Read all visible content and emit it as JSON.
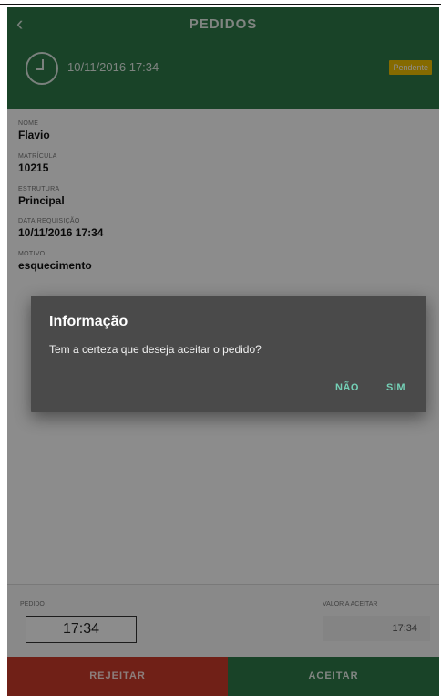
{
  "appbar": {
    "title": "PEDIDOS",
    "back_icon": "chevron-left-icon"
  },
  "header": {
    "datetime": "10/11/2016 17:34",
    "status": "Pendente"
  },
  "details": {
    "fields": [
      {
        "label": "NOME",
        "value": "Flavio"
      },
      {
        "label": "MATRÍCULA",
        "value": "10215"
      },
      {
        "label": "ESTRUTURA",
        "value": "Principal"
      },
      {
        "label": "DATA REQUISIÇÃO",
        "value": "10/11/2016 17:34"
      },
      {
        "label": "MOTIVO",
        "value": "esquecimento"
      }
    ]
  },
  "bottom": {
    "pedido_label": "PEDIDO",
    "pedido_value": "17:34",
    "valor_label": "VALOR A ACEITAR",
    "valor_value": "17:34"
  },
  "actions": {
    "reject": "REJEITAR",
    "accept": "ACEITAR"
  },
  "dialog": {
    "title": "Informação",
    "message": "Tem a certeza que deseja aceitar o pedido?",
    "no": "NÃO",
    "yes": "SIM"
  },
  "colors": {
    "primary": "#2f7a4a",
    "reject": "#cc3b2a",
    "badge": "#f2c200",
    "dialog_accent": "#74d0b6"
  }
}
